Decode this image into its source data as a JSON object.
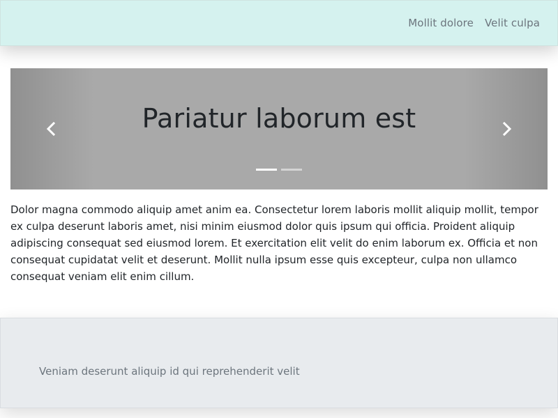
{
  "navbar": {
    "links": [
      "Mollit dolore",
      "Velit culpa"
    ]
  },
  "carousel": {
    "title": "Pariatur laborum est",
    "slide_count": 2,
    "active_slide": 1,
    "prev_icon": "chevron-left-icon",
    "next_icon": "chevron-right-icon"
  },
  "content": {
    "paragraph": "Dolor magna commodo aliquip amet anim ea. Consectetur lorem laboris mollit aliquip mollit, tempor ex culpa deserunt laboris amet, nisi minim eiusmod dolor quis ipsum qui officia. Proident aliquip adipiscing consequat sed eiusmod lorem. Et exercitation elit velit do enim laborum ex. Officia et non consequat cupidatat velit et deserunt. Mollit nulla ipsum esse quis excepteur, culpa non ullamco consequat veniam elit enim cillum."
  },
  "footer": {
    "text": "Veniam deserunt aliquip id qui reprehenderit velit"
  },
  "colors": {
    "navbar_bg": "#d5f2ef",
    "carousel_bg": "#a9a9a9",
    "footer_bg": "#e8ebee",
    "muted_text": "#6c757d"
  }
}
